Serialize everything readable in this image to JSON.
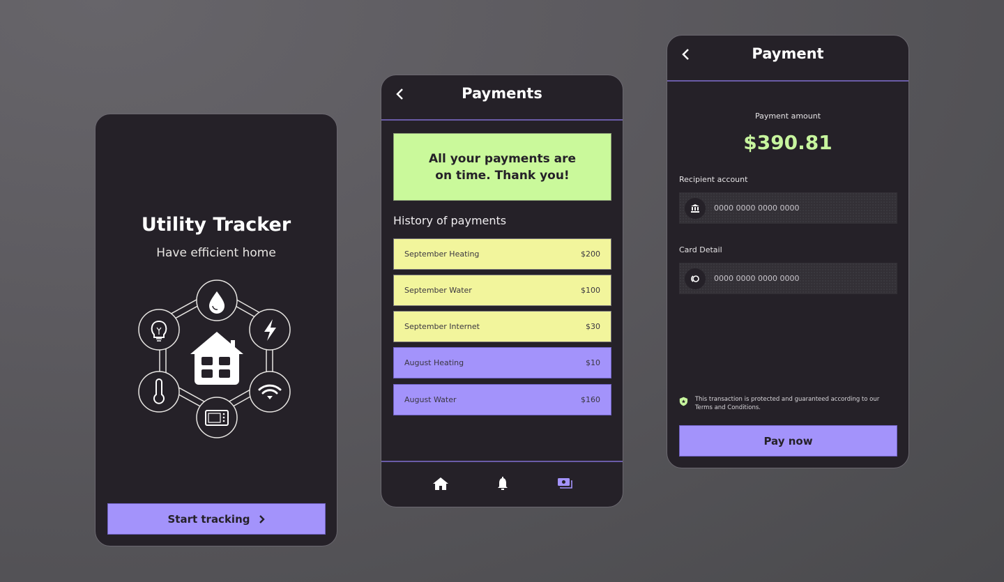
{
  "colors": {
    "accent_purple": "#a393fb",
    "accent_green": "#caf99b",
    "accent_yellow": "#f2f59c",
    "amount_green": "#c7f59e",
    "screen_bg": "#252128",
    "divider": "#6a5ca8"
  },
  "welcome": {
    "title": "Utility Tracker",
    "subtitle": "Have efficient home",
    "hub_icons": [
      "water-drop-icon",
      "lightning-icon",
      "wifi-icon",
      "microwave-icon",
      "thermometer-icon",
      "lightbulb-icon",
      "house-icon"
    ],
    "start_button": "Start tracking",
    "start_icon": "chevron-right-icon"
  },
  "payments": {
    "title": "Payments",
    "back_icon": "chevron-left-icon",
    "banner": "All your payments are\non time. Thank you!",
    "history_title": "History of payments",
    "history": [
      {
        "label": "September Heating",
        "amount": "$200",
        "status": "current"
      },
      {
        "label": "September Water",
        "amount": "$100",
        "status": "current"
      },
      {
        "label": "September Internet",
        "amount": "$30",
        "status": "current"
      },
      {
        "label": "August Heating",
        "amount": "$10",
        "status": "past"
      },
      {
        "label": "August Water",
        "amount": "$160",
        "status": "past"
      }
    ],
    "nav": [
      {
        "icon": "home-icon",
        "active": false
      },
      {
        "icon": "bell-icon",
        "active": false
      },
      {
        "icon": "money-icon",
        "active": true
      }
    ]
  },
  "payment": {
    "title": "Payment",
    "back_icon": "chevron-left-icon",
    "amount_label": "Payment amount",
    "amount": "$390.81",
    "recipient_label": "Recipient account",
    "recipient_value": "0000 0000 0000 0000",
    "recipient_icon": "bank-icon",
    "card_label": "Card Detail",
    "card_value": "0000 0000 0000 0000",
    "card_icon": "card-brand-icon",
    "secure_text": "This transaction is protected and guaranteed according to our Terms and Conditions.",
    "secure_icon": "shield-star-icon",
    "pay_button": "Pay now"
  }
}
